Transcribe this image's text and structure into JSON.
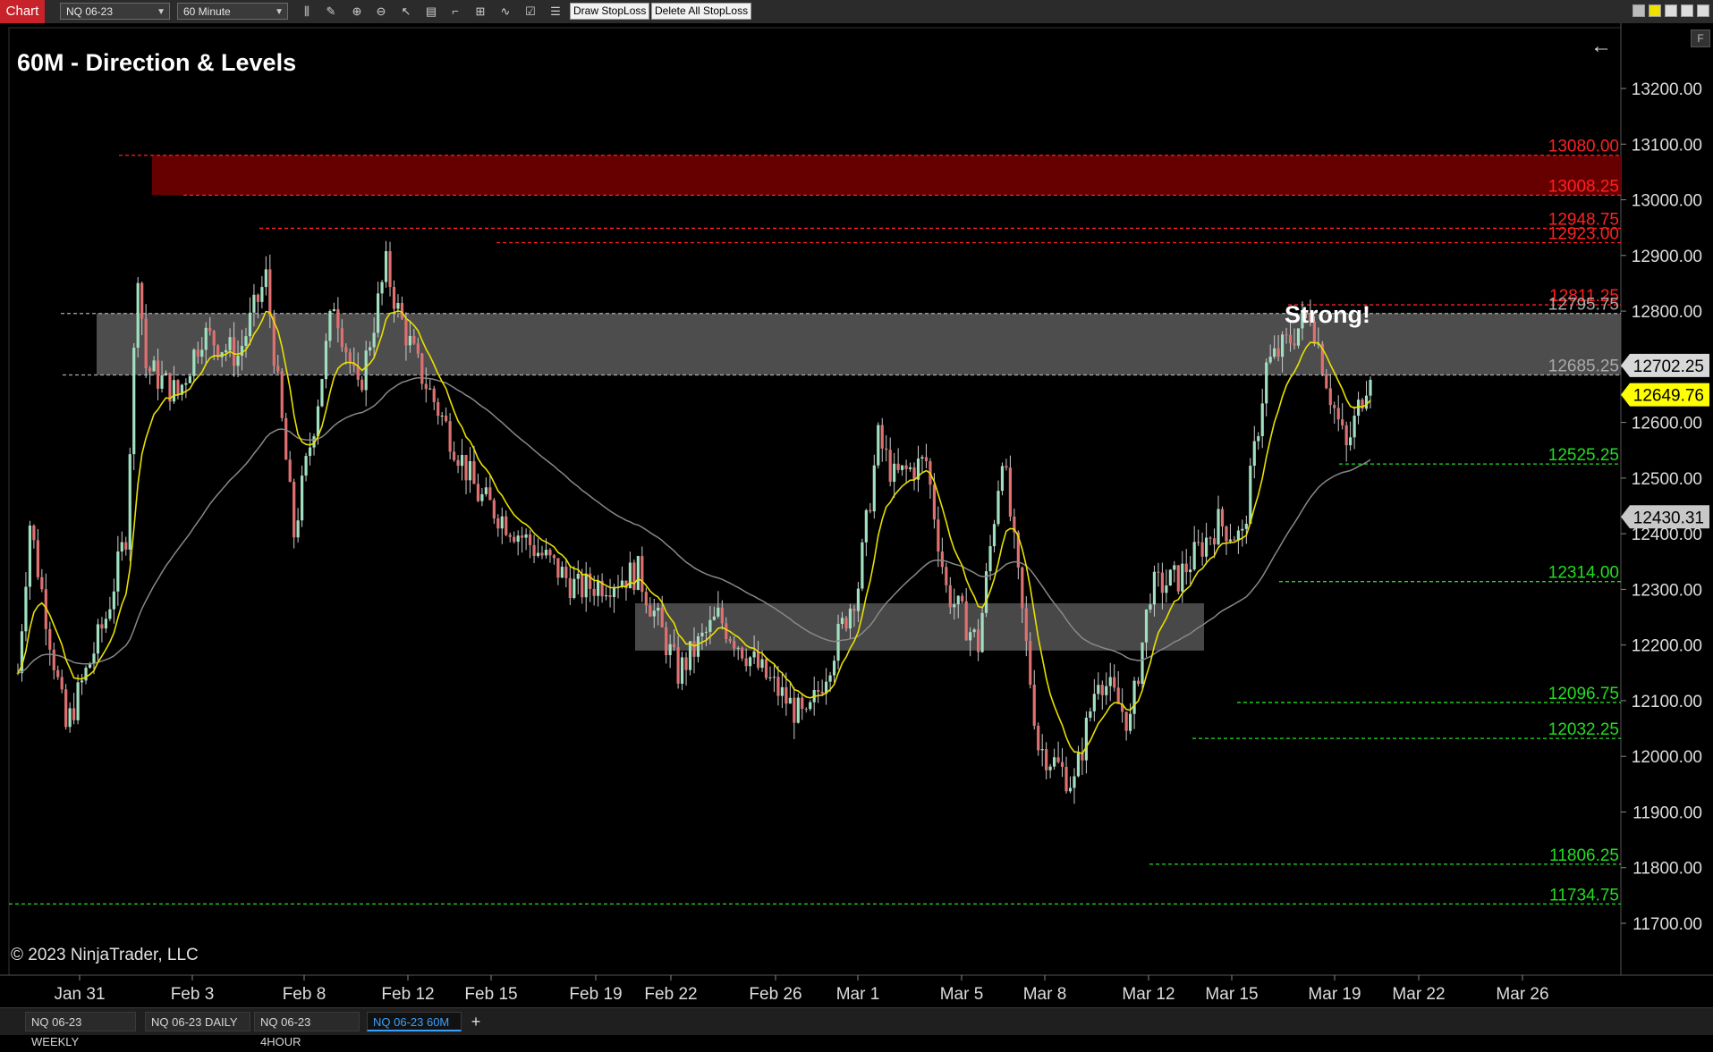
{
  "toolbar": {
    "chart_tab": "Chart",
    "instrument": "NQ 06-23",
    "interval": "60 Minute",
    "draw_stoploss": "Draw StopLoss",
    "delete_stoploss": "Delete All StopLoss",
    "icons": [
      "bar-style-icon",
      "pencil-icon",
      "zoom-in-icon",
      "zoom-out-icon",
      "cursor-icon",
      "data-box-icon",
      "drawing-tools-icon",
      "strategies-icon",
      "indicators-icon",
      "properties-icon",
      "list-icon"
    ]
  },
  "chart": {
    "title": "60M - Direction & Levels",
    "copyright": "© 2023 NinjaTrader, LLC",
    "annotation": "Strong!",
    "f_button": "F"
  },
  "chart_data": {
    "type": "candlestick",
    "instrument": "NQ 06-23",
    "interval": "60 Minute",
    "ylim": [
      11650,
      13300
    ],
    "y_ticks": [
      "13200.00",
      "13100.00",
      "13000.00",
      "12900.00",
      "12800.00",
      "12700.00",
      "12600.00",
      "12500.00",
      "12400.00",
      "12300.00",
      "12200.00",
      "12100.00",
      "12000.00",
      "11900.00",
      "11800.00",
      "11700.00"
    ],
    "x_ticks": [
      "Jan 31",
      "Feb 3",
      "Feb 8",
      "Feb 12",
      "Feb 15",
      "Feb 19",
      "Feb 22",
      "Feb 26",
      "Mar 1",
      "Mar 5",
      "Mar 8",
      "Mar 12",
      "Mar 15",
      "Mar 19",
      "Mar 22",
      "Mar 26"
    ],
    "price_path": [
      [
        0,
        12150
      ],
      [
        3,
        12420
      ],
      [
        12,
        12050
      ],
      [
        22,
        12250
      ],
      [
        27,
        12400
      ],
      [
        30,
        12880
      ],
      [
        32,
        12700
      ],
      [
        40,
        12650
      ],
      [
        46,
        12760
      ],
      [
        55,
        12720
      ],
      [
        62,
        12860
      ],
      [
        69,
        12400
      ],
      [
        74,
        12600
      ],
      [
        79,
        12820
      ],
      [
        85,
        12650
      ],
      [
        92,
        12880
      ],
      [
        95,
        12800
      ],
      [
        100,
        12700
      ],
      [
        115,
        12470
      ],
      [
        140,
        12300
      ],
      [
        155,
        12330
      ],
      [
        165,
        12150
      ],
      [
        175,
        12250
      ],
      [
        186,
        12150
      ],
      [
        197,
        12060
      ],
      [
        210,
        12310
      ],
      [
        215,
        12570
      ],
      [
        219,
        12500
      ],
      [
        227,
        12530
      ],
      [
        232,
        12300
      ],
      [
        240,
        12200
      ],
      [
        246,
        12550
      ],
      [
        255,
        12020
      ],
      [
        264,
        11950
      ],
      [
        270,
        12150
      ],
      [
        278,
        12060
      ],
      [
        283,
        12300
      ],
      [
        290,
        12320
      ],
      [
        300,
        12420
      ],
      [
        306,
        12390
      ],
      [
        312,
        12700
      ],
      [
        318,
        12750
      ],
      [
        323,
        12800
      ],
      [
        328,
        12650
      ],
      [
        332,
        12550
      ],
      [
        338,
        12700
      ]
    ],
    "zones": [
      {
        "name": "resistance",
        "low": 13008.25,
        "high": 13080,
        "color": "#6b0000"
      },
      {
        "name": "upper-grey",
        "low": 12685.25,
        "high": 12795.75,
        "color": "#5a5a5a"
      },
      {
        "name": "mid-grey",
        "low": 12190,
        "high": 12275,
        "color": "#555555"
      }
    ],
    "levels": [
      {
        "value": 13080,
        "label": "13080.00",
        "color": "#ff2020"
      },
      {
        "value": 13008.25,
        "label": "13008.25",
        "color": "#ff2020"
      },
      {
        "value": 12948.75,
        "label": "12948.75",
        "color": "#ff2020"
      },
      {
        "value": 12923,
        "label": "12923.00",
        "color": "#ff2020"
      },
      {
        "value": 12811.25,
        "label": "12811.25",
        "color": "#ff2020"
      },
      {
        "value": 12795.75,
        "label": "12795.75",
        "color": "#aaaaaa"
      },
      {
        "value": 12685.25,
        "label": "12685.25",
        "color": "#aaaaaa"
      },
      {
        "value": 12525.25,
        "label": "12525.25",
        "color": "#22dd22"
      },
      {
        "value": 12314,
        "label": "12314.00",
        "color": "#22dd22"
      },
      {
        "value": 12096.75,
        "label": "12096.75",
        "color": "#22dd22"
      },
      {
        "value": 12032.25,
        "label": "12032.25",
        "color": "#22dd22"
      },
      {
        "value": 11806.25,
        "label": "11806.25",
        "color": "#22dd22"
      },
      {
        "value": 11734.75,
        "label": "11734.75",
        "color": "#22dd22"
      }
    ],
    "price_markers": [
      {
        "label": "12702.25",
        "value": 12702.25,
        "bg": "#d8d8d8",
        "fg": "#000000"
      },
      {
        "label": "12649.76",
        "value": 12649.76,
        "bg": "#ffff00",
        "fg": "#000000"
      },
      {
        "label": "12430.31",
        "value": 12430.31,
        "bg": "#c8c8c8",
        "fg": "#000000"
      }
    ],
    "indicators": [
      {
        "name": "fast-ma",
        "color": "#e8e000"
      },
      {
        "name": "slow-ma",
        "color": "#888888"
      }
    ],
    "grid": false
  },
  "bottom_tabs": [
    {
      "label": "NQ 06-23 WEEKLY",
      "active": false
    },
    {
      "label": "NQ 06-23 DAILY",
      "active": false
    },
    {
      "label": "NQ 06-23 4HOUR",
      "active": false
    },
    {
      "label": "NQ 06-23 60M",
      "active": true
    }
  ],
  "colors": {
    "background": "#000000",
    "up_candle": "#a0e0c0",
    "down_candle": "#e07070",
    "accent_tab": "#3aa0ff"
  }
}
